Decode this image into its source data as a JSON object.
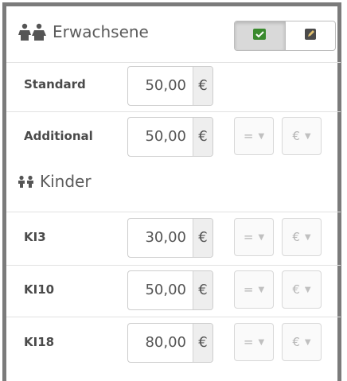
{
  "sections": {
    "adults": {
      "title": "Erwachsene"
    },
    "children": {
      "title": "Kinder"
    }
  },
  "toggle": {
    "left_icon": "checkbox-icon",
    "right_icon": "edit-icon",
    "accent": "#3a8a2e"
  },
  "rows": [
    {
      "label": "Standard",
      "value": "50,00",
      "currency": "€"
    },
    {
      "label": "Additional",
      "value": "50,00",
      "currency": "€",
      "operator": "=",
      "unit": "€"
    },
    {
      "label": "KI3",
      "value": "30,00",
      "currency": "€",
      "operator": "=",
      "unit": "€"
    },
    {
      "label": "KI10",
      "value": "50,00",
      "currency": "€",
      "operator": "=",
      "unit": "€"
    },
    {
      "label": "KI18",
      "value": "80,00",
      "currency": "€",
      "operator": "=",
      "unit": "€"
    }
  ]
}
